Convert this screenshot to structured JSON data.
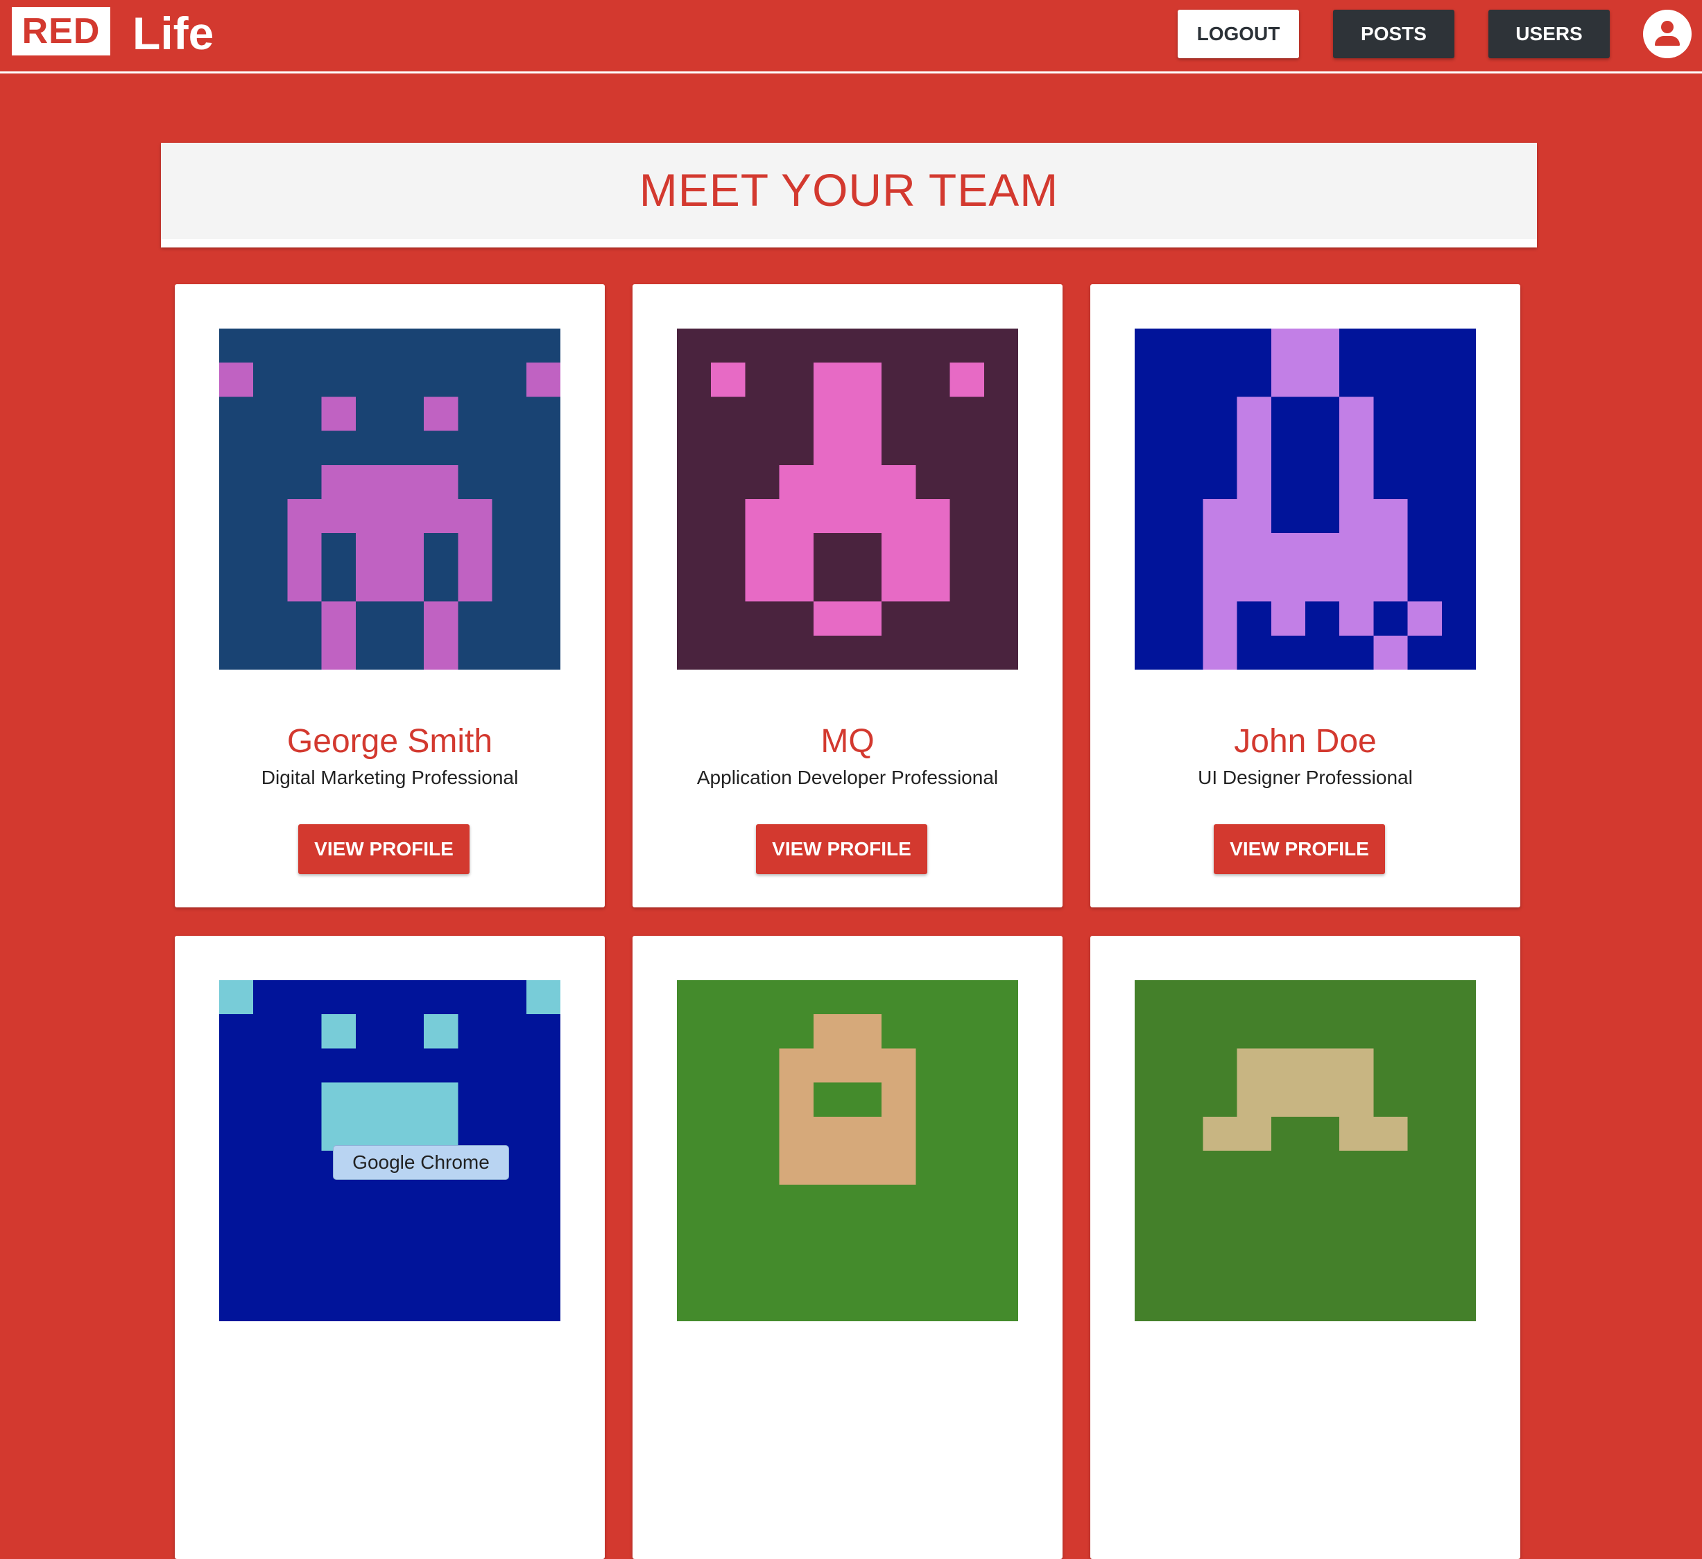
{
  "header": {
    "logo_badge": "RED",
    "logo_text": "Life",
    "nav": {
      "logout_label": "LOGOUT",
      "posts_label": "POSTS",
      "users_label": "USERS"
    },
    "avatar_icon": "account-circle-icon"
  },
  "page": {
    "title": "MEET YOUR TEAM"
  },
  "team": [
    {
      "name": "George Smith",
      "role": "Digital Marketing Professional",
      "button": "VIEW PROFILE",
      "avatar_bg": "#194373",
      "avatar_fg": "#c062c2"
    },
    {
      "name": "MQ",
      "role": "Application Developer Professional",
      "button": "VIEW PROFILE",
      "avatar_bg": "#4a233e",
      "avatar_fg": "#e76ac5"
    },
    {
      "name": "John Doe",
      "role": "UI Designer Professional",
      "button": "VIEW PROFILE",
      "avatar_bg": "#01149a",
      "avatar_fg": "#c27fe6"
    },
    {
      "name": "",
      "role": "",
      "button": "",
      "avatar_bg": "#01149a",
      "avatar_fg": "#78ccd8"
    },
    {
      "name": "",
      "role": "",
      "button": "",
      "avatar_bg": "#448b2c",
      "avatar_fg": "#d6a97a"
    },
    {
      "name": "",
      "role": "",
      "button": "",
      "avatar_bg": "#44802a",
      "avatar_fg": "#c8b582"
    }
  ],
  "tooltip": "Google Chrome",
  "colors": {
    "brand_red": "#d3392f",
    "dark_button": "#2e3338",
    "banner_bg": "#f4f4f4"
  }
}
